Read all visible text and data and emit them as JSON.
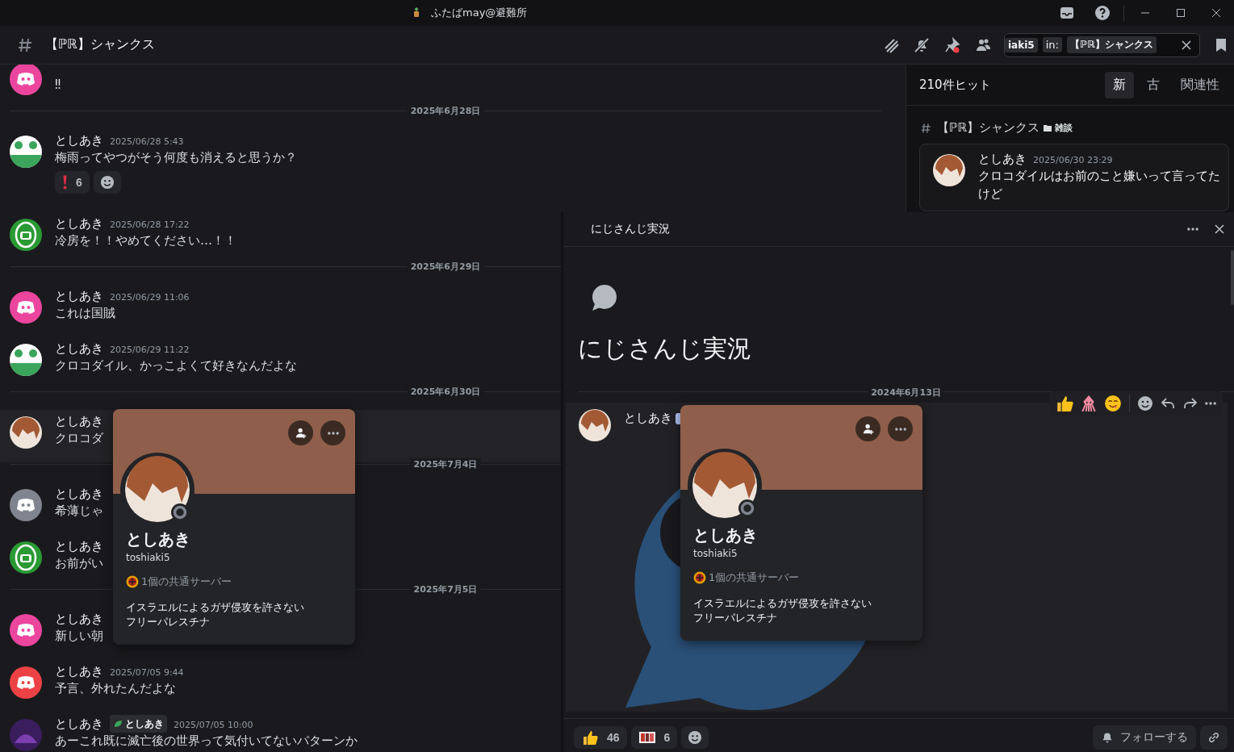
{
  "title_bar": {
    "title": "ふたばmay@避難所"
  },
  "channel": {
    "name": "【ℙℝ】シャンクス",
    "search": {
      "chips": [
        "iaki5",
        "in:",
        "【ℙℝ】シャンクス"
      ]
    },
    "messages": [
      {
        "kind": "message",
        "avatar": {
          "kind": "discord",
          "color": "#eb459e"
        },
        "text": "‼",
        "highlighted": false
      },
      {
        "kind": "divider",
        "date": "2025年6月28日"
      },
      {
        "kind": "message",
        "avatar": {
          "kind": "frog"
        },
        "author": "としあき",
        "time": "2025/06/28 5:43",
        "text": "梅雨ってやつがそう何度も消えると思うか？",
        "highlighted": false,
        "reactions": [
          {
            "kind": "exclaim",
            "count": "6"
          }
        ]
      },
      {
        "kind": "message",
        "avatar": {
          "kind": "helmet"
        },
        "author": "としあき",
        "time": "2025/06/28 17:22",
        "text": "冷房を！！やめてください…！！",
        "highlighted": false
      },
      {
        "kind": "divider",
        "date": "2025年6月29日"
      },
      {
        "kind": "message",
        "avatar": {
          "kind": "discord",
          "color": "#eb459e"
        },
        "author": "としあき",
        "time": "2025/06/29 11:06",
        "text": "これは国賊",
        "highlighted": false
      },
      {
        "kind": "message",
        "avatar": {
          "kind": "frog"
        },
        "author": "としあき",
        "time": "2025/06/29 11:22",
        "text": "クロコダイル、かっこよくて好きなんだよな",
        "highlighted": false
      },
      {
        "kind": "divider",
        "date": "2025年6月30日"
      },
      {
        "kind": "message",
        "avatar": {
          "kind": "character"
        },
        "author": "としあき",
        "text": "クロコダ",
        "highlighted": true
      },
      {
        "kind": "divider",
        "date": "2025年7月4日"
      },
      {
        "kind": "message",
        "avatar": {
          "kind": "discord",
          "color": "#80848e"
        },
        "author": "としあき",
        "text": "希薄じゃ",
        "highlighted": false
      },
      {
        "kind": "message",
        "avatar": {
          "kind": "helmet"
        },
        "author": "としあき",
        "text": "お前がい",
        "highlighted": false
      },
      {
        "kind": "divider",
        "date": "2025年7月5日"
      },
      {
        "kind": "message",
        "avatar": {
          "kind": "discord",
          "color": "#eb459e"
        },
        "author": "としあき",
        "text": "新しい朝",
        "highlighted": false
      },
      {
        "kind": "message",
        "avatar": {
          "kind": "discord",
          "color": "#ed4245"
        },
        "author": "としあき",
        "time": "2025/07/05 9:44",
        "text": "予言、外れたんだよな",
        "highlighted": false
      },
      {
        "kind": "message",
        "avatar": {
          "kind": "hooded"
        },
        "author": "としあき",
        "tag": "としあき",
        "time": "2025/07/05 10:00",
        "text": "あーこれ既に滅亡後の世界って気付いてないパターンか",
        "highlighted": false
      }
    ],
    "profile_card": {
      "display_name": "としあき",
      "username": "toshiaki5",
      "mutual": "1個の共通サーバー",
      "bio": [
        "イスラエルによるガザ侵攻を許さない",
        "フリーパレスチナ"
      ]
    }
  },
  "search_results": {
    "count": "210件ヒット",
    "sort_tabs": [
      {
        "label": "新",
        "selected": true
      },
      {
        "label": "古",
        "selected": false
      },
      {
        "label": "関連性",
        "selected": false
      }
    ],
    "results": [
      {
        "channel": "【ℙℝ】シャンクス",
        "category": "雑談",
        "author": "としあき",
        "time": "2025/06/30 23:29",
        "text": "クロコダイルはお前のこと嫌いって言ってたけど"
      }
    ]
  },
  "thread_panel": {
    "title": "にじさんじ実況",
    "heading": "にじさんじ実況",
    "date": "2024年6月13日",
    "post": {
      "author": "としあき"
    },
    "quick_reactions": [
      {
        "kind": "thumbs"
      },
      {
        "kind": "squid"
      },
      {
        "kind": "yum"
      }
    ],
    "reactions": [
      {
        "kind": "thumbs",
        "count": "46"
      },
      {
        "kind": "image",
        "count": "6"
      }
    ],
    "follow": "フォローする",
    "profile_card": {
      "display_name": "としあき",
      "username": "toshiaki5",
      "mutual": "1個の共通サーバー",
      "bio": [
        "イスラエルによるガザ侵攻を許さない",
        "フリーパレスチナ"
      ]
    }
  }
}
